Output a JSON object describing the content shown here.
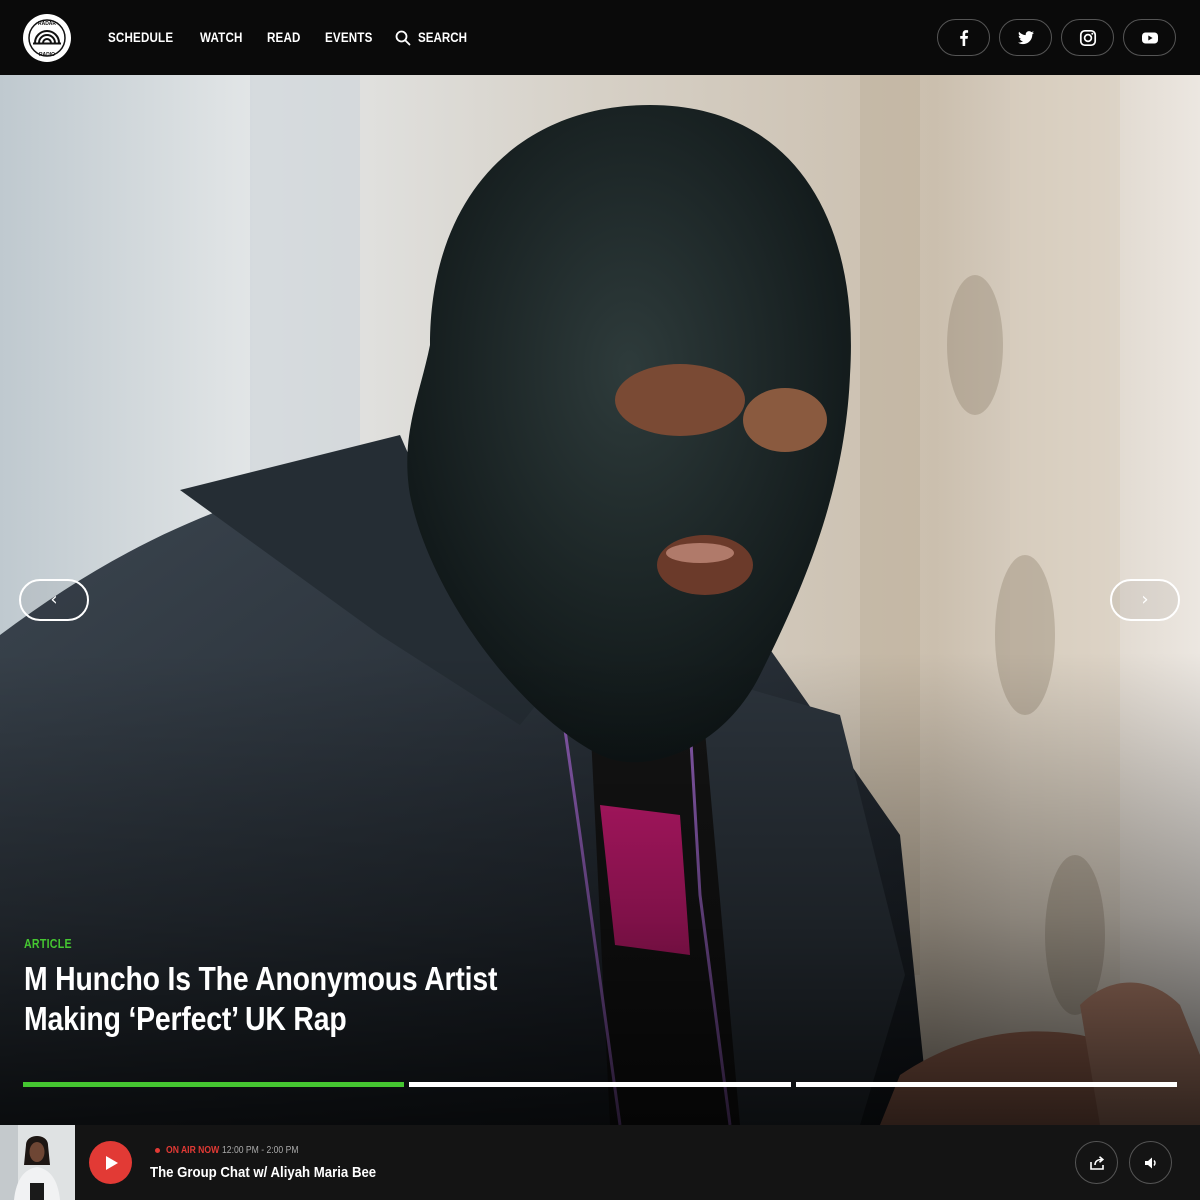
{
  "header": {
    "logo_alt": "Radar Radio",
    "nav": [
      {
        "label": "SCHEDULE"
      },
      {
        "label": "WATCH"
      },
      {
        "label": "READ"
      },
      {
        "label": "EVENTS"
      }
    ],
    "search_label": "SEARCH",
    "socials": [
      {
        "icon": "facebook-icon"
      },
      {
        "icon": "twitter-icon"
      },
      {
        "icon": "instagram-icon"
      },
      {
        "icon": "youtube-icon"
      }
    ]
  },
  "hero": {
    "tag": "ARTICLE",
    "title_line1": "M Huncho Is The Anonymous Artist",
    "title_line2": "Making ‘Perfect’ UK Rap",
    "prev_icon": "‹",
    "next_icon": "›",
    "slides": [
      {
        "progress": 1.0,
        "active": true
      },
      {
        "progress": 0.0,
        "active": false
      },
      {
        "progress": 0.0,
        "active": false
      }
    ],
    "accent": "#45c631"
  },
  "player": {
    "live_label": "ON AIR NOW",
    "time_range": "12:00 PM - 2:00 PM",
    "show_title": "The Group Chat w/ Aliyah Maria Bee",
    "play_color": "#e23a35"
  }
}
